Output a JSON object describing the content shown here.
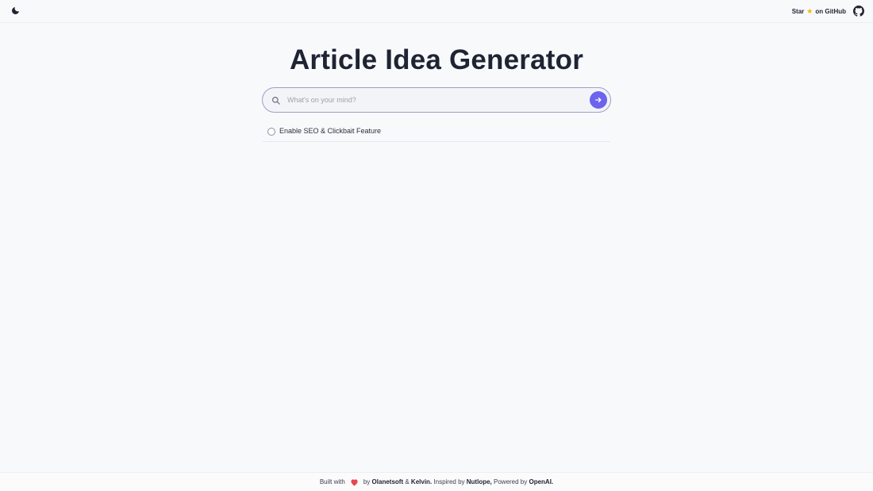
{
  "header": {
    "theme_icon": "moon-icon",
    "github_star_label": "Star",
    "github_star_icon": "star-icon",
    "github_suffix": "on GitHub",
    "github_icon": "github-icon"
  },
  "main": {
    "title": "Article Idea Generator",
    "search": {
      "placeholder": "What's on your mind?",
      "value": ""
    },
    "seo_option": {
      "label": "Enable SEO & Clickbait Feature",
      "checked": false
    }
  },
  "footer": {
    "built_with": "Built with",
    "by": "by",
    "author1": "Olanetsoft",
    "amp": "&",
    "author2": "Kelvin.",
    "inspired_by": "Inspired by",
    "inspiration": "Nutlope,",
    "powered_by": "Powered by",
    "powered": "OpenAI.",
    "heart_color": "#e5484d"
  },
  "colors": {
    "accent": "#6c63ef",
    "background": "#f8f9fb"
  }
}
